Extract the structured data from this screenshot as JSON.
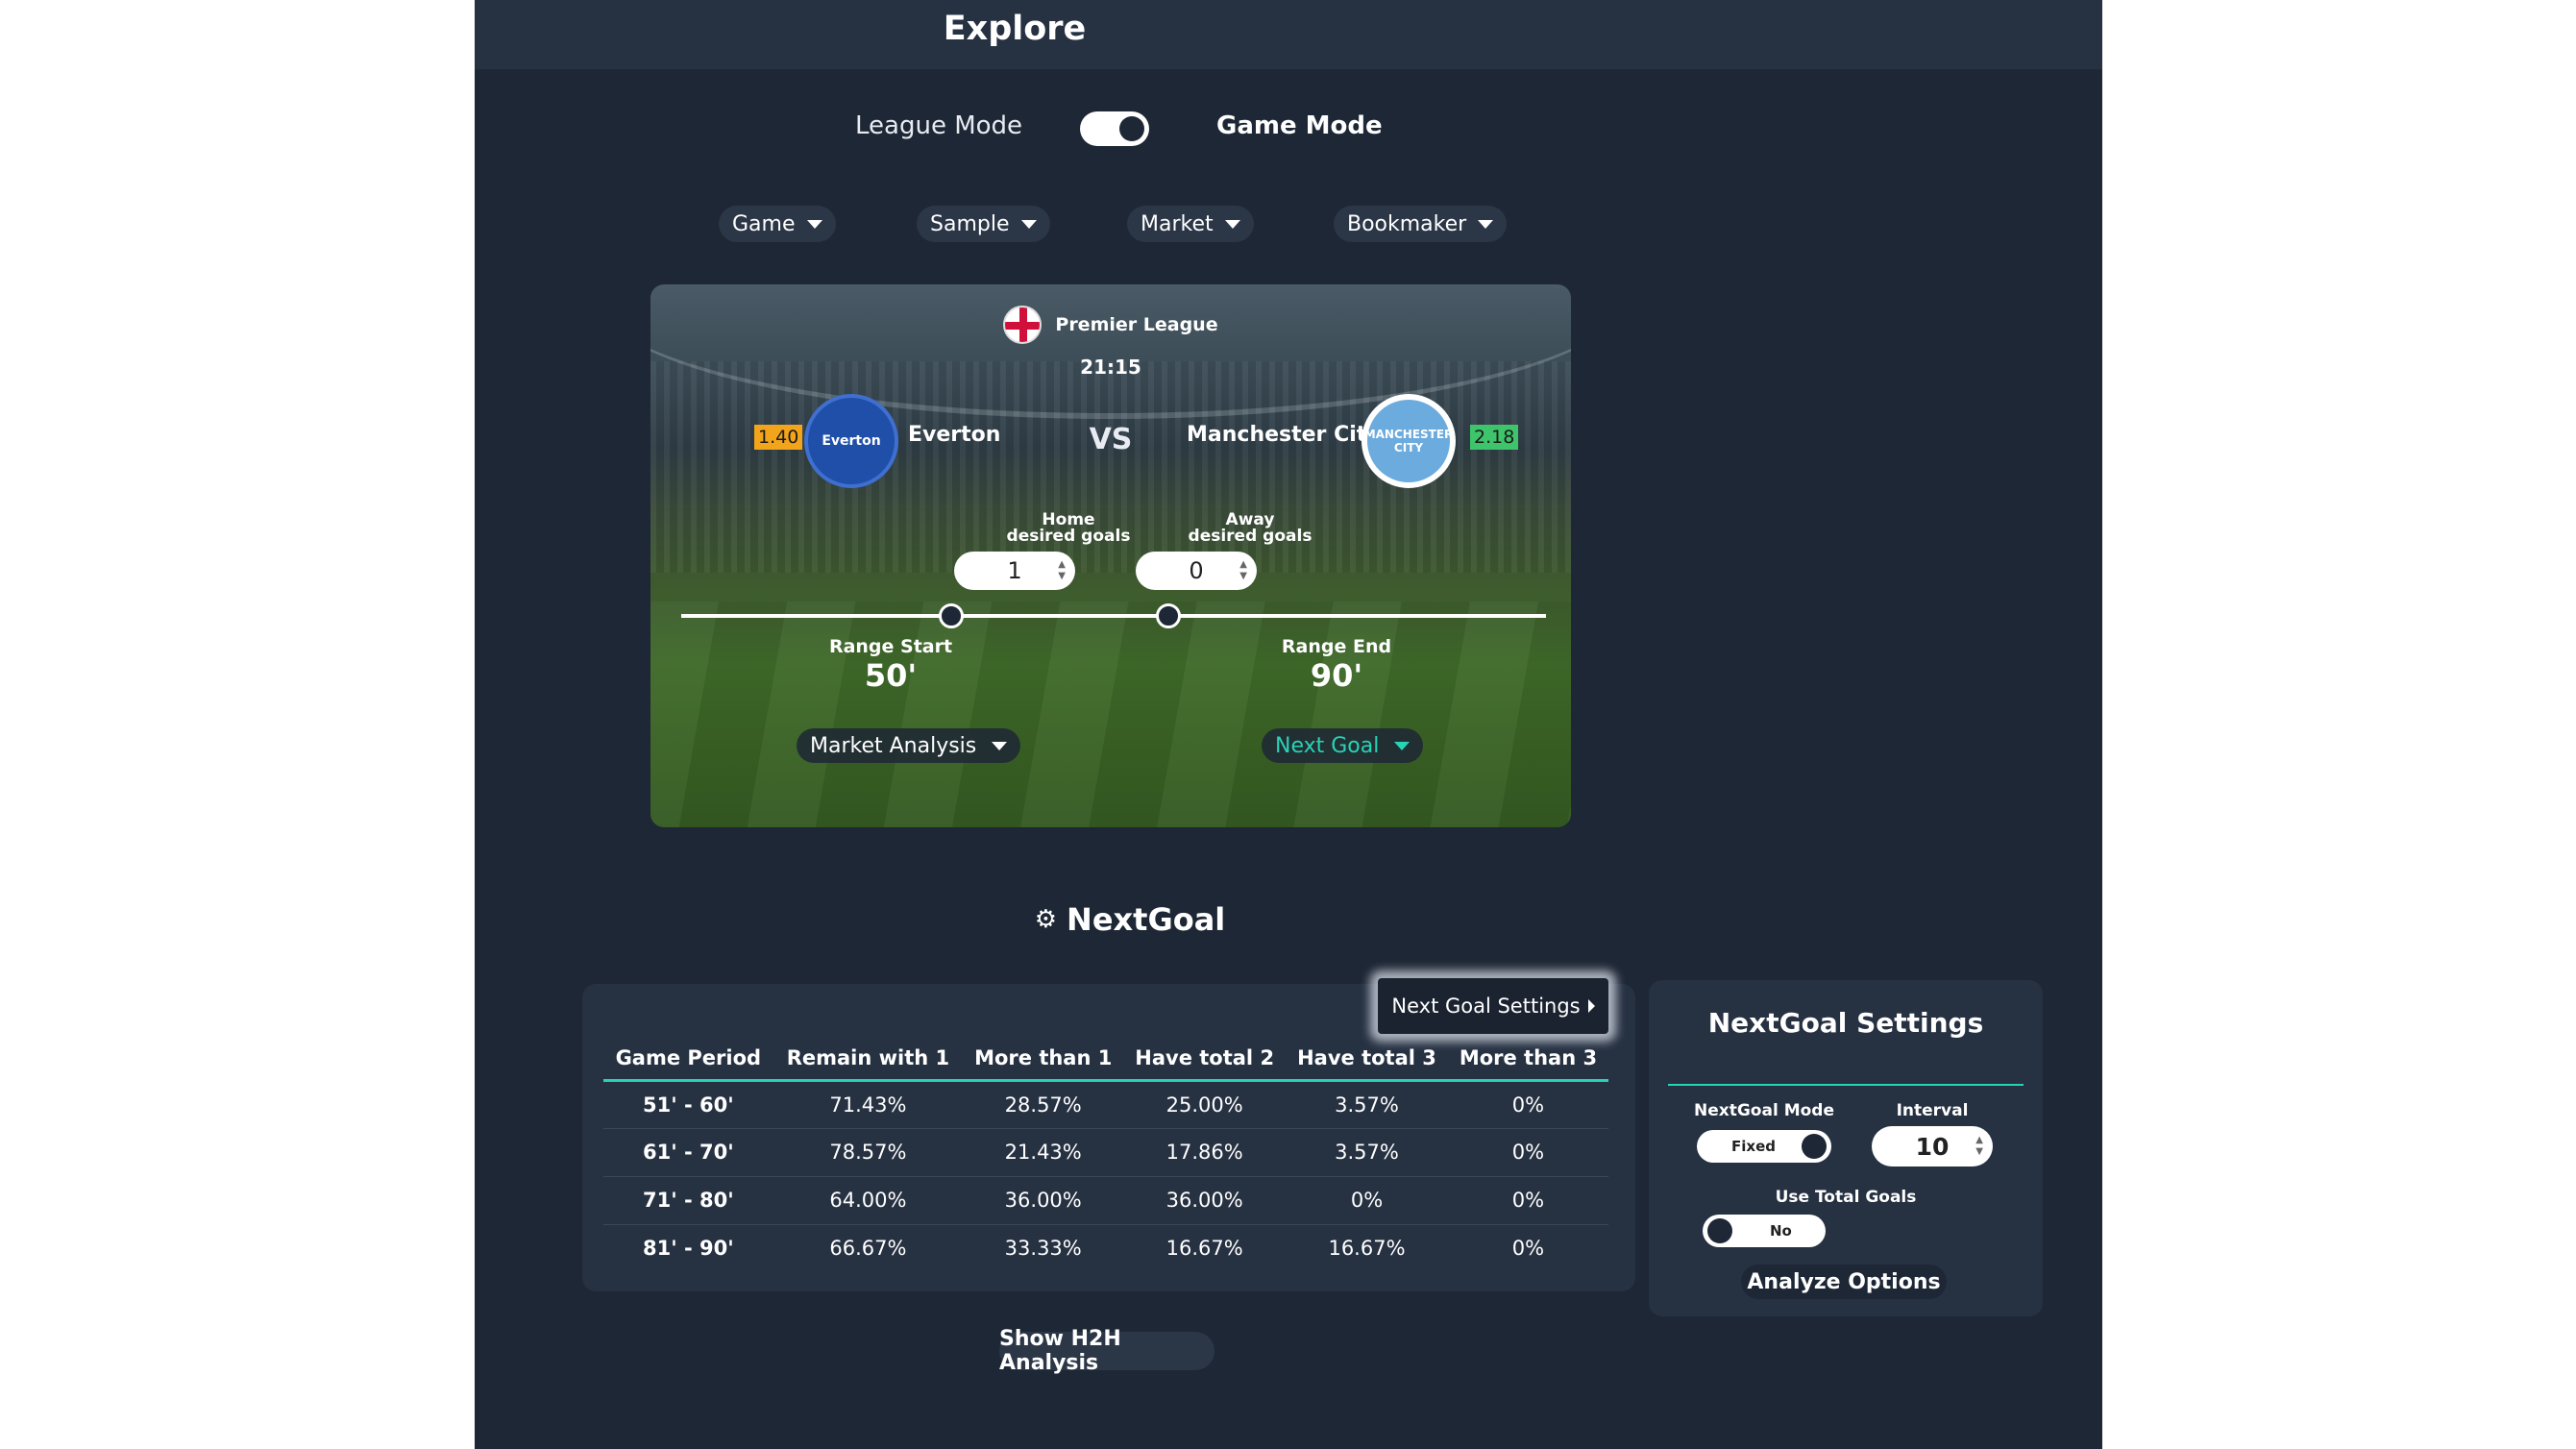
{
  "header": {
    "title": "Explore"
  },
  "mode": {
    "left_label": "League Mode",
    "right_label": "Game Mode",
    "selected": "Game Mode"
  },
  "filters": [
    {
      "label": "Game"
    },
    {
      "label": "Sample"
    },
    {
      "label": "Market"
    },
    {
      "label": "Bookmaker"
    }
  ],
  "match": {
    "league": "Premier League",
    "time": "21:15",
    "home_team": "Everton",
    "away_team": "Manchester City",
    "vs": "VS",
    "home_odd": "1.40",
    "away_odd": "2.18",
    "home_crest_text": "Everton",
    "away_crest_text": "MANCHESTER CITY",
    "home_goals_label_1": "Home",
    "home_goals_label_2": "desired goals",
    "away_goals_label_1": "Away",
    "away_goals_label_2": "desired goals",
    "home_goals": "1",
    "away_goals": "0",
    "range_start_label": "Range Start",
    "range_start": "50'",
    "range_end_label": "Range End",
    "range_end": "90'",
    "market_analysis": "Market Analysis",
    "next_goal": "Next Goal",
    "colors": {
      "home_odd": "#f2a51a",
      "away_odd": "#3ec46a",
      "accent": "#27d3b7"
    }
  },
  "nextgoal": {
    "title": "NextGoal",
    "icon": "soccer-ball-icon",
    "settings_button": "Next Goal Settings",
    "columns": [
      "Game Period",
      "Remain with 1",
      "More than 1",
      "Have total 2",
      "Have total 3",
      "More than 3"
    ],
    "rows": [
      [
        "51' - 60'",
        "71.43%",
        "28.57%",
        "25.00%",
        "3.57%",
        "0%"
      ],
      [
        "61' - 70'",
        "78.57%",
        "21.43%",
        "17.86%",
        "3.57%",
        "0%"
      ],
      [
        "71' - 80'",
        "64.00%",
        "36.00%",
        "36.00%",
        "0%",
        "0%"
      ],
      [
        "81' - 90'",
        "66.67%",
        "33.33%",
        "16.67%",
        "16.67%",
        "0%"
      ]
    ]
  },
  "settings": {
    "title": "NextGoal Settings",
    "mode_label": "NextGoal Mode",
    "mode_value": "Fixed",
    "interval_label": "Interval",
    "interval_value": "10",
    "total_goals_label": "Use Total Goals",
    "total_goals_value": "No",
    "analyze": "Analyze Options"
  },
  "h2h": {
    "label": "Show H2H Analysis"
  }
}
